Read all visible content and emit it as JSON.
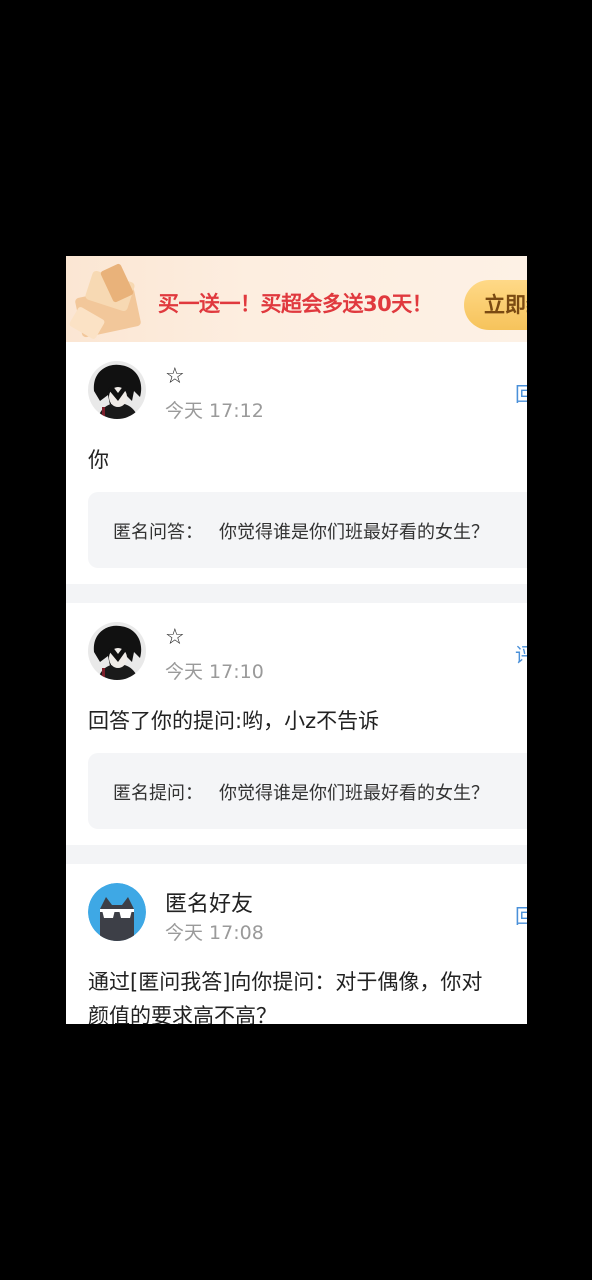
{
  "banner": {
    "promo_text": "买一送一！买超会多送30天！",
    "button_label": "立即续"
  },
  "posts": [
    {
      "name": "☆",
      "time": "今天 17:12",
      "side_action": "回",
      "content": "你",
      "quote_label": "匿名问答：",
      "quote_text": "你觉得谁是你们班最好看的女生？"
    },
    {
      "name": "☆",
      "time": "今天 17:10",
      "side_action": "评",
      "content": "回答了你的提问:哟，小z不告诉",
      "quote_label": "匿名提问：",
      "quote_text": "你觉得谁是你们班最好看的女生？"
    },
    {
      "name": "匿名好友",
      "time": "今天 17:08",
      "side_action": "回",
      "content_line1": "通过[匿问我答]向你提问：对于偶像，你对",
      "content_line2": "颜值的要求高不高？"
    }
  ],
  "colors": {
    "accent_blue": "#4a90d9",
    "promo_red": "#e0393e",
    "button_gold": "#f6c35b",
    "anon_avatar_blue": "#3ea8e5"
  }
}
